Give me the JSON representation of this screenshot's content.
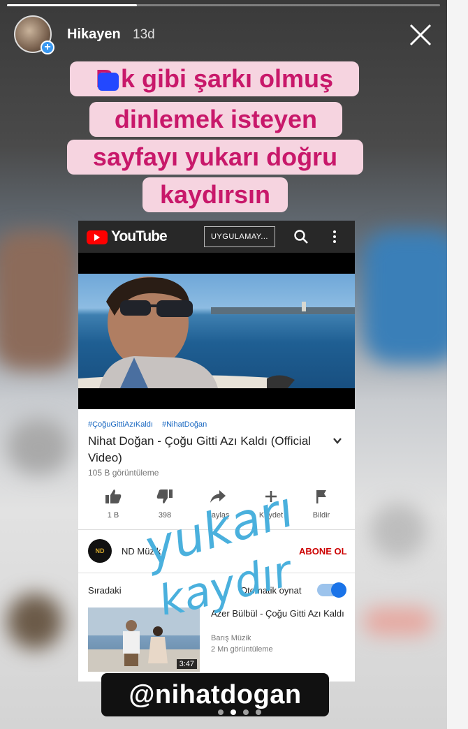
{
  "story": {
    "user": "Hikayen",
    "time": "13d",
    "progress": 0.3,
    "caption_lines": [
      "B k gibi şarkı olmuş",
      "dinlemek isteyen",
      "sayfayı yukarı doğru",
      "kaydırsın"
    ],
    "mention": "@nihatdogan",
    "handwriting_lines": [
      "yukarı",
      "kaydır"
    ],
    "caption_color": "#c8186a",
    "caption_bg": "#f6d4e0",
    "handwriting_color": "#4ab0dd"
  },
  "youtube": {
    "logo_text": "YouTube",
    "app_button": "UYGULAMAY...",
    "hashtags": [
      "#ÇoğuGittiAzıKaldı",
      "#NihatDoğan"
    ],
    "title": "Nihat Doğan - Çoğu Gitti Azı Kaldı (Official Video)",
    "views": "105 B görüntüleme",
    "actions": [
      {
        "icon": "thumbs-up-icon",
        "label": "1 B"
      },
      {
        "icon": "thumbs-down-icon",
        "label": "398"
      },
      {
        "icon": "share-icon",
        "label": "Paylaş"
      },
      {
        "icon": "add-to-playlist-icon",
        "label": "Kaydet"
      },
      {
        "icon": "flag-icon",
        "label": "Bildir"
      }
    ],
    "channel_avatar_text": "ND",
    "channel_name": "ND Müzik",
    "subscribe": "ABONE OL",
    "next_label": "Sıradaki",
    "autoplay_label": "Otomatik oynat",
    "autoplay_on": true,
    "recommended": {
      "title": "Azer Bülbül - Çoğu Gitti Azı Kaldı",
      "channel": "Barış Müzik",
      "views": "2 Mn görüntüleme",
      "duration": "3:47"
    },
    "brand_red": "#ff0000",
    "link_blue": "#1565c0"
  }
}
